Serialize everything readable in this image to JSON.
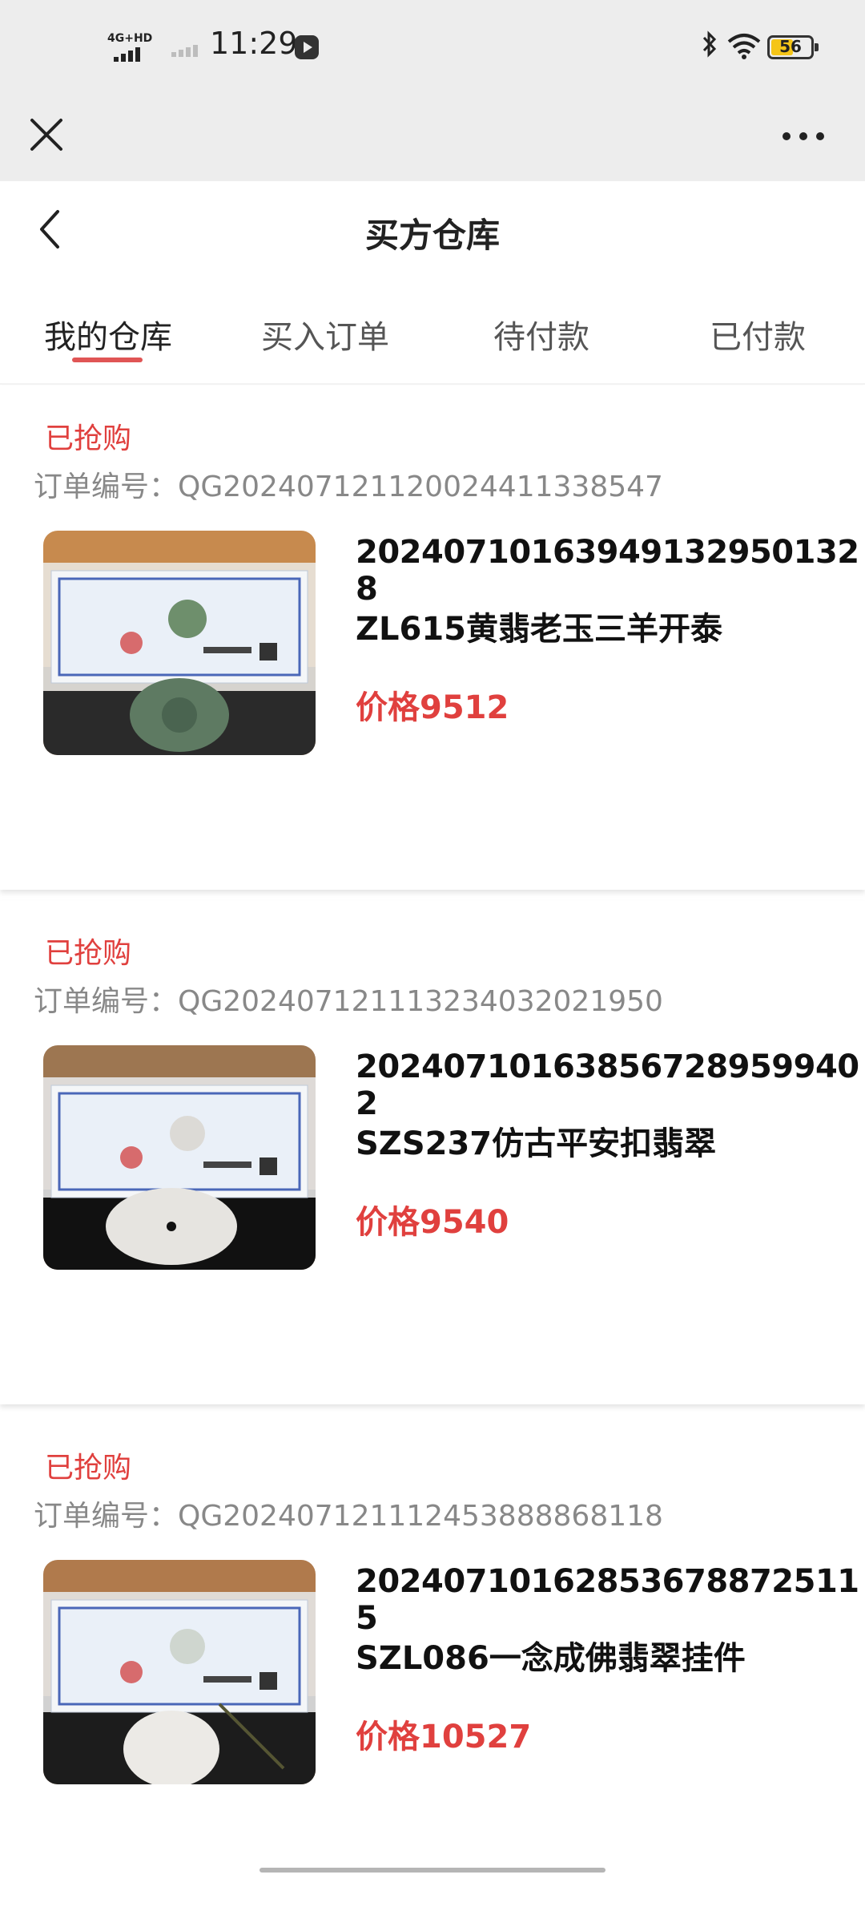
{
  "status_bar": {
    "network": "4G+HD",
    "time": "11:29",
    "battery": "56",
    "battery_level": 0.56
  },
  "header": {
    "title": "买方仓库"
  },
  "tabs": [
    {
      "label": "我的仓库",
      "active": true
    },
    {
      "label": "买入订单",
      "active": false
    },
    {
      "label": "待付款",
      "active": false
    },
    {
      "label": "已付款",
      "active": false
    }
  ],
  "orders": [
    {
      "status": "已抢购",
      "order_no": "订单编号：QG20240712112002441133854​7",
      "code": "20240710163949132950132​8",
      "name": "ZL615黄翡老玉三羊开泰",
      "price": "价格9512"
    },
    {
      "status": "已抢购",
      "order_no": "订单编号：QG20240712111323403202195​0",
      "code": "20240710163856728959940​2",
      "name": "SZS237仿古平安扣翡翠",
      "price": "价格9540"
    },
    {
      "status": "已抢购",
      "order_no": "订单编号：QG20240712111245388886811​8",
      "code": "20240710162853678872511​5",
      "name": "SZL086一念成佛翡翠挂件",
      "price": "价格10527"
    }
  ],
  "colors": {
    "accent": "#e0403e",
    "topbar_bg": "#ededed"
  }
}
